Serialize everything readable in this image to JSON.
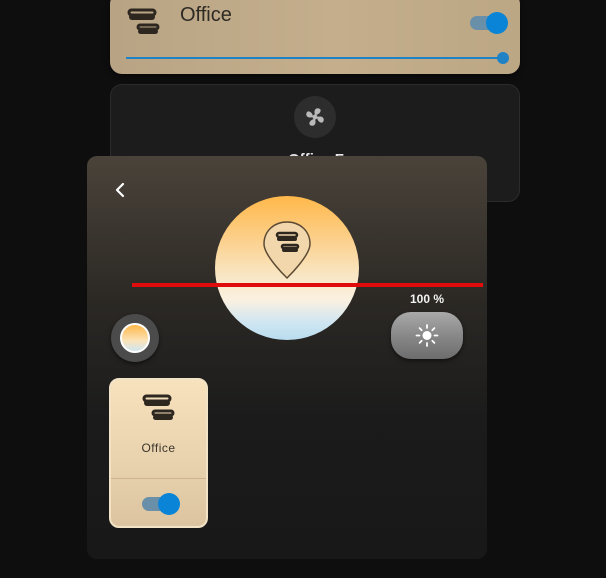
{
  "top_card": {
    "title": "Office",
    "toggle_on": true,
    "brightness": 1.0,
    "icon": "ceiling-light-icon"
  },
  "fan_card": {
    "name": "Office F",
    "icon": "fan-icon"
  },
  "dialog": {
    "back_icon": "chevron-left-icon",
    "brightness_label": "100 %",
    "brightness_icon": "sun-icon",
    "temperature_icon": "color-temperature-icon",
    "tile": {
      "name": "Office",
      "icon": "ceiling-light-icon",
      "toggle_on": true
    }
  },
  "colors": {
    "accent": "#0a84d6",
    "warm": "#ffb84a",
    "red_line": "#e00c0c"
  }
}
